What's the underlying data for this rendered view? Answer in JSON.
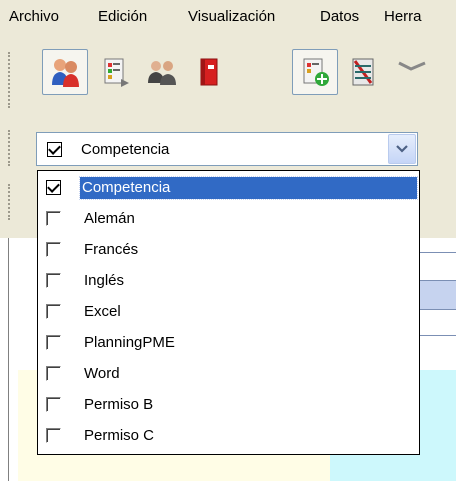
{
  "menu": {
    "items": [
      "Archivo",
      "Edición",
      "Visualización",
      "Datos",
      "Herra"
    ]
  },
  "toolbar": {
    "buttons": [
      {
        "icon": "users-icon",
        "active": true
      },
      {
        "icon": "report-icon",
        "active": false
      },
      {
        "icon": "group-icon",
        "active": false
      },
      {
        "icon": "binder-icon",
        "active": false
      },
      {
        "icon": "add-report-icon",
        "active": true
      },
      {
        "icon": "table-icon",
        "active": false
      },
      {
        "icon": "link-icon",
        "active": false
      }
    ]
  },
  "filter": {
    "label": "Competencia",
    "checked": true
  },
  "dropdown": {
    "options": [
      {
        "label": "Competencia",
        "checked": true,
        "selected": true
      },
      {
        "label": "Alemán",
        "checked": false,
        "selected": false
      },
      {
        "label": "Francés",
        "checked": false,
        "selected": false
      },
      {
        "label": "Inglés",
        "checked": false,
        "selected": false
      },
      {
        "label": "Excel",
        "checked": false,
        "selected": false
      },
      {
        "label": "PlanningPME",
        "checked": false,
        "selected": false
      },
      {
        "label": "Word",
        "checked": false,
        "selected": false
      },
      {
        "label": "Permiso B",
        "checked": false,
        "selected": false
      },
      {
        "label": "Permiso C",
        "checked": false,
        "selected": false
      }
    ]
  },
  "colors": {
    "selection": "#316ac5",
    "chrome": "#ece9d8",
    "yellow_area": "#fffde6",
    "cyan_area": "#cdf8fc"
  }
}
